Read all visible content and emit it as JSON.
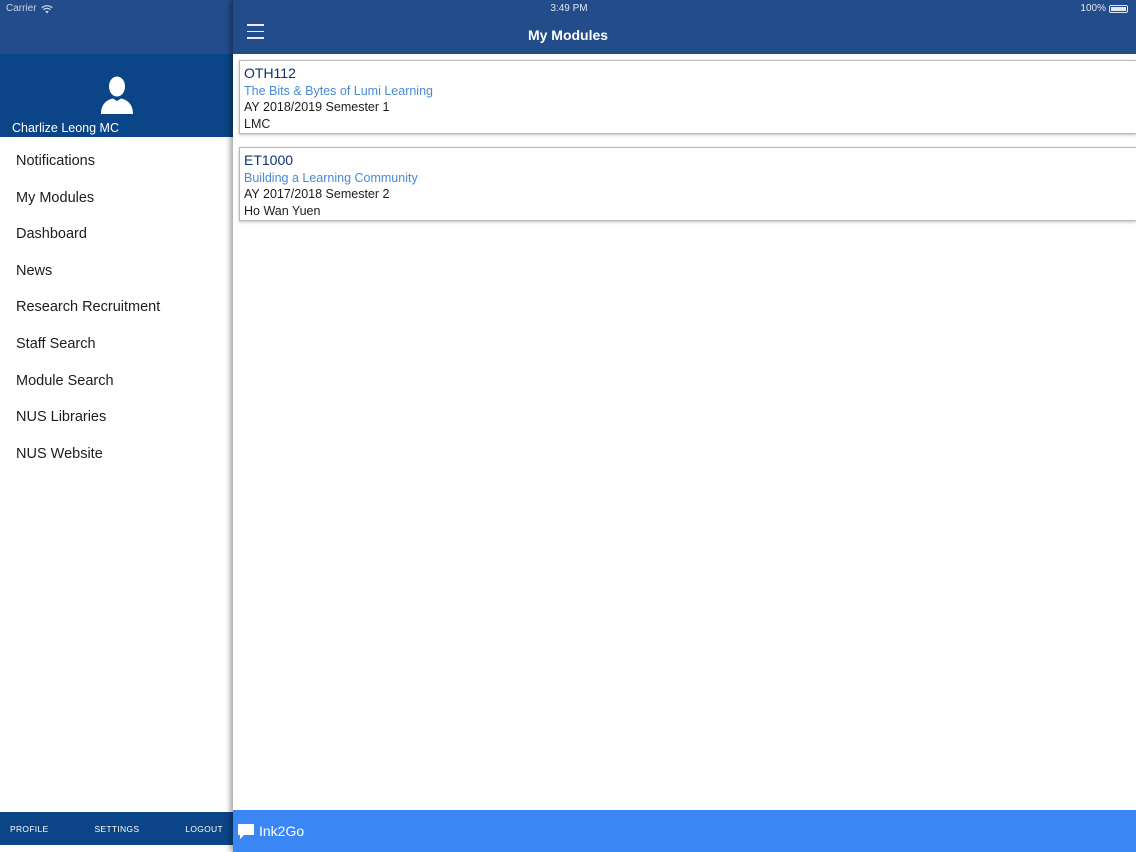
{
  "status_bar": {
    "carrier": "Carrier",
    "time": "3:49 PM",
    "battery": "100%"
  },
  "sidebar": {
    "user_name": "Charlize Leong MC",
    "menu_items": [
      {
        "label": "Notifications"
      },
      {
        "label": "My Modules"
      },
      {
        "label": "Dashboard"
      },
      {
        "label": "News"
      },
      {
        "label": "Research Recruitment"
      },
      {
        "label": "Staff Search"
      },
      {
        "label": "Module Search"
      },
      {
        "label": "NUS Libraries"
      },
      {
        "label": "NUS Website"
      }
    ],
    "footer": {
      "profile": "PROFILE",
      "settings": "SETTINGS",
      "logout": "LOGOUT"
    }
  },
  "header": {
    "title": "My Modules",
    "menu_icon": "hamburger-menu-icon"
  },
  "modules": [
    {
      "code": "OTH112",
      "title": "The Bits & Bytes of Lumi Learning",
      "term": "AY 2018/2019 Semester 1",
      "lecturer": "LMC"
    },
    {
      "code": "ET1000",
      "title": "Building a Learning Community",
      "term": "AY 2017/2018 Semester 2",
      "lecturer": "Ho Wan Yuen"
    }
  ],
  "bottom_bar": {
    "app_name": "Ink2Go",
    "icon": "chat-bubble-icon"
  },
  "colors": {
    "header_blue": "#234c8a",
    "sidebar_blue": "#0c4587",
    "bottom_bar_blue": "#3a86f5",
    "link_blue": "#4a8ad4",
    "code_navy": "#0d3270"
  }
}
